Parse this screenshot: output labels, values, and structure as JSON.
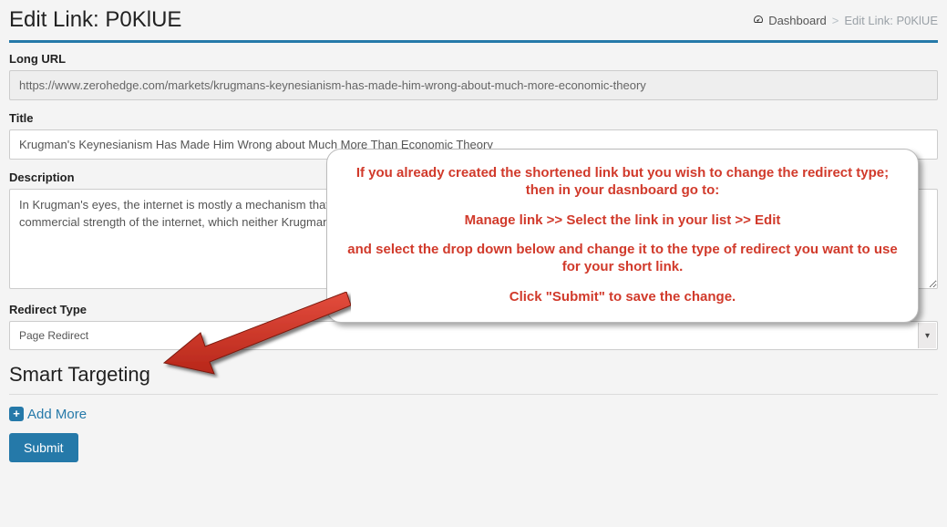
{
  "header": {
    "title": "Edit Link: P0KlUE"
  },
  "breadcrumb": {
    "dashboard_label": "Dashboard",
    "separator": ">",
    "current": "Edit Link: P0KlUE"
  },
  "form": {
    "long_url": {
      "label": "Long URL",
      "value": "https://www.zerohedge.com/markets/krugmans-keynesianism-has-made-him-wrong-about-much-more-economic-theory"
    },
    "title": {
      "label": "Title",
      "value": "Krugman's Keynesianism Has Made Him Wrong about Much More Than Economic Theory"
    },
    "description": {
      "label": "Description",
      "value": "In Krugman's eyes, the internet is mostly a mechanism that permits us to send frivolous messages to each other but doesn't fundamentally change anything. Yet what is the commercial strength of the internet, which neither Krugman nor many other people at the time recognized?"
    },
    "redirect_type": {
      "label": "Redirect Type",
      "selected": "Page Redirect"
    }
  },
  "smart_targeting": {
    "heading": "Smart Targeting",
    "add_more_label": "Add More"
  },
  "actions": {
    "submit_label": "Submit"
  },
  "callout": {
    "line1": "If you already created the shortened link but you wish to change the redirect type; then in your dasnboard go to:",
    "line2": "Manage link >> Select the link in your list >> Edit",
    "line3": "and select the drop down below and change it to the type of redirect you want to use for your short link.",
    "line4": "Click \"Submit\" to save the change."
  }
}
